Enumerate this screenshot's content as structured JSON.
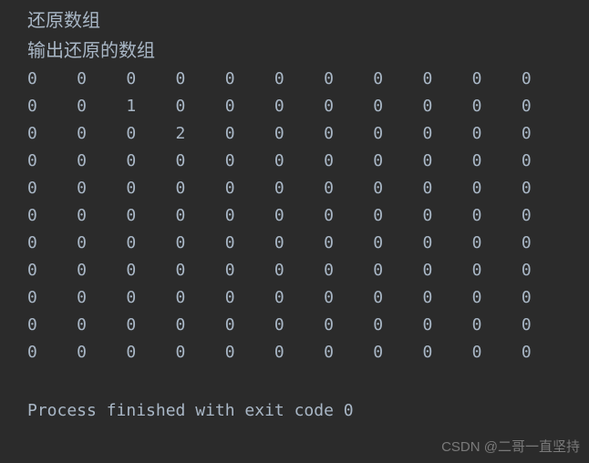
{
  "headers": {
    "line1": "还原数组",
    "line2": "输出还原的数组"
  },
  "chart_data": {
    "type": "table",
    "title": "还原数组",
    "rows": 11,
    "cols": 11,
    "values": [
      [
        0,
        0,
        0,
        0,
        0,
        0,
        0,
        0,
        0,
        0,
        0
      ],
      [
        0,
        0,
        1,
        0,
        0,
        0,
        0,
        0,
        0,
        0,
        0
      ],
      [
        0,
        0,
        0,
        2,
        0,
        0,
        0,
        0,
        0,
        0,
        0
      ],
      [
        0,
        0,
        0,
        0,
        0,
        0,
        0,
        0,
        0,
        0,
        0
      ],
      [
        0,
        0,
        0,
        0,
        0,
        0,
        0,
        0,
        0,
        0,
        0
      ],
      [
        0,
        0,
        0,
        0,
        0,
        0,
        0,
        0,
        0,
        0,
        0
      ],
      [
        0,
        0,
        0,
        0,
        0,
        0,
        0,
        0,
        0,
        0,
        0
      ],
      [
        0,
        0,
        0,
        0,
        0,
        0,
        0,
        0,
        0,
        0,
        0
      ],
      [
        0,
        0,
        0,
        0,
        0,
        0,
        0,
        0,
        0,
        0,
        0
      ],
      [
        0,
        0,
        0,
        0,
        0,
        0,
        0,
        0,
        0,
        0,
        0
      ],
      [
        0,
        0,
        0,
        0,
        0,
        0,
        0,
        0,
        0,
        0,
        0
      ]
    ]
  },
  "footer": {
    "process_msg": "Process finished with exit code 0"
  },
  "watermark": {
    "text": "CSDN @二哥一直坚持"
  }
}
